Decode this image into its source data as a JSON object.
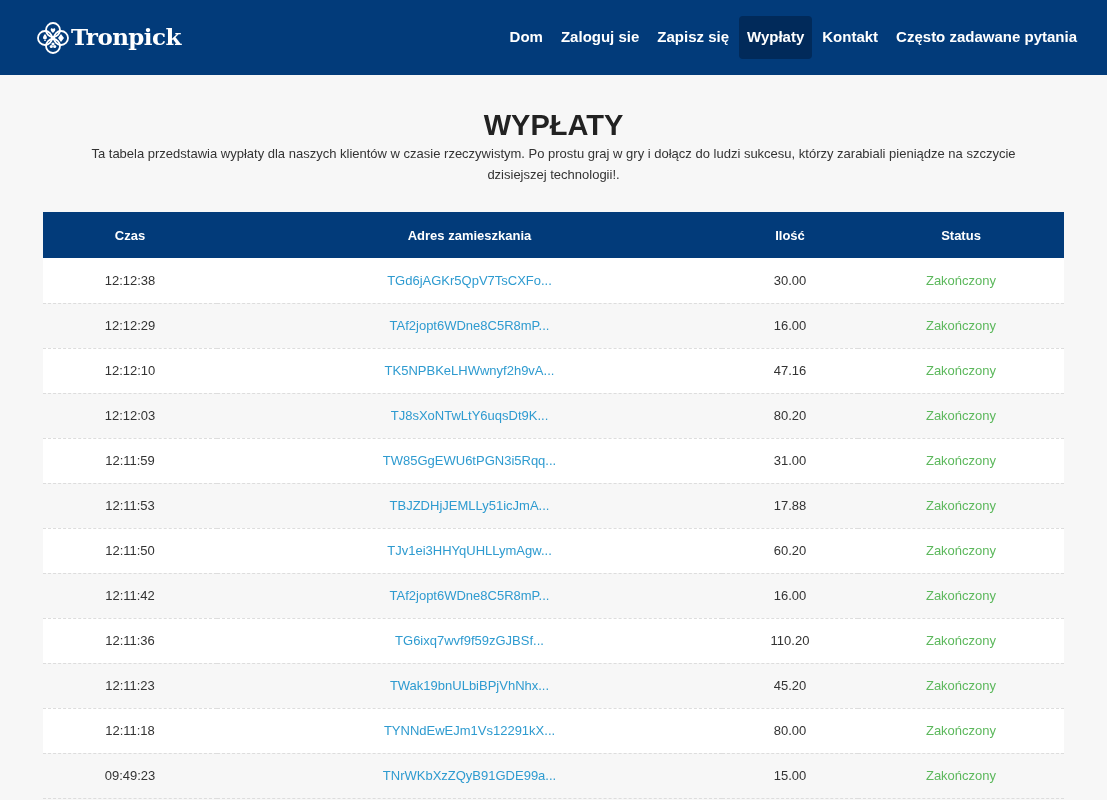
{
  "header": {
    "logo": "Tronpick",
    "nav": [
      {
        "label": "Dom",
        "selected": false
      },
      {
        "label": "Zaloguj sie",
        "selected": false
      },
      {
        "label": "Zapisz się",
        "selected": false
      },
      {
        "label": "Wypłaty",
        "selected": true
      },
      {
        "label": "Kontakt",
        "selected": false
      },
      {
        "label": "Często zadawane pytania",
        "selected": false
      }
    ]
  },
  "title": "WYPŁATY",
  "intro": "Ta tabela przedstawia wypłaty dla naszych klientów w czasie rzeczywistym. Po prostu graj w gry i dołącz do ludzi sukcesu, którzy zarabiali pieniądze na szczycie dzisiejszej technologii!.",
  "table": {
    "columns": [
      "Czas",
      "Adres zamieszkania",
      "Ilość",
      "Status"
    ],
    "rows": [
      {
        "time": "12:12:38",
        "address": "TGd6jAGKr5QpV7TsCXFo...",
        "amount": "30.00",
        "status": "Zakończony"
      },
      {
        "time": "12:12:29",
        "address": "TAf2jopt6WDne8C5R8mP...",
        "amount": "16.00",
        "status": "Zakończony"
      },
      {
        "time": "12:12:10",
        "address": "TK5NPBKeLHWwnyf2h9vA...",
        "amount": "47.16",
        "status": "Zakończony"
      },
      {
        "time": "12:12:03",
        "address": "TJ8sXoNTwLtY6uqsDt9K...",
        "amount": "80.20",
        "status": "Zakończony"
      },
      {
        "time": "12:11:59",
        "address": "TW85GgEWU6tPGN3i5Rqq...",
        "amount": "31.00",
        "status": "Zakończony"
      },
      {
        "time": "12:11:53",
        "address": "TBJZDHjJEMLLy51icJmA...",
        "amount": "17.88",
        "status": "Zakończony"
      },
      {
        "time": "12:11:50",
        "address": "TJv1ei3HHYqUHLLymAgw...",
        "amount": "60.20",
        "status": "Zakończony"
      },
      {
        "time": "12:11:42",
        "address": "TAf2jopt6WDne8C5R8mP...",
        "amount": "16.00",
        "status": "Zakończony"
      },
      {
        "time": "12:11:36",
        "address": "TG6ixq7wvf9f59zGJBSf...",
        "amount": "110.20",
        "status": "Zakończony"
      },
      {
        "time": "12:11:23",
        "address": "TWak19bnULbiBPjVhNhx...",
        "amount": "45.20",
        "status": "Zakończony"
      },
      {
        "time": "12:11:18",
        "address": "TYNNdEwEJm1Vs12291kX...",
        "amount": "80.00",
        "status": "Zakończony"
      },
      {
        "time": "09:49:23",
        "address": "TNrWKbXzZQyB91GDE99a...",
        "amount": "15.00",
        "status": "Zakończony"
      }
    ]
  }
}
